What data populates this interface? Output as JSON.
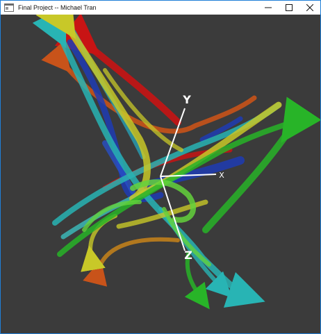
{
  "window": {
    "title": "Final Project -- Michael Tran",
    "controls": [
      "minimize-icon",
      "maximize-icon",
      "close-icon"
    ]
  },
  "scene": {
    "background": "#3b3b3b",
    "axes": {
      "x_label": "X",
      "y_label": "Y",
      "z_label": "Z"
    },
    "ribbon_colors": {
      "red": "#c81414",
      "orange": "#c8531a",
      "yellow": "#c8c828",
      "cyan": "#28b4b4",
      "blue": "#1e3cb4",
      "green": "#28b428",
      "lime": "#64d23c"
    }
  }
}
